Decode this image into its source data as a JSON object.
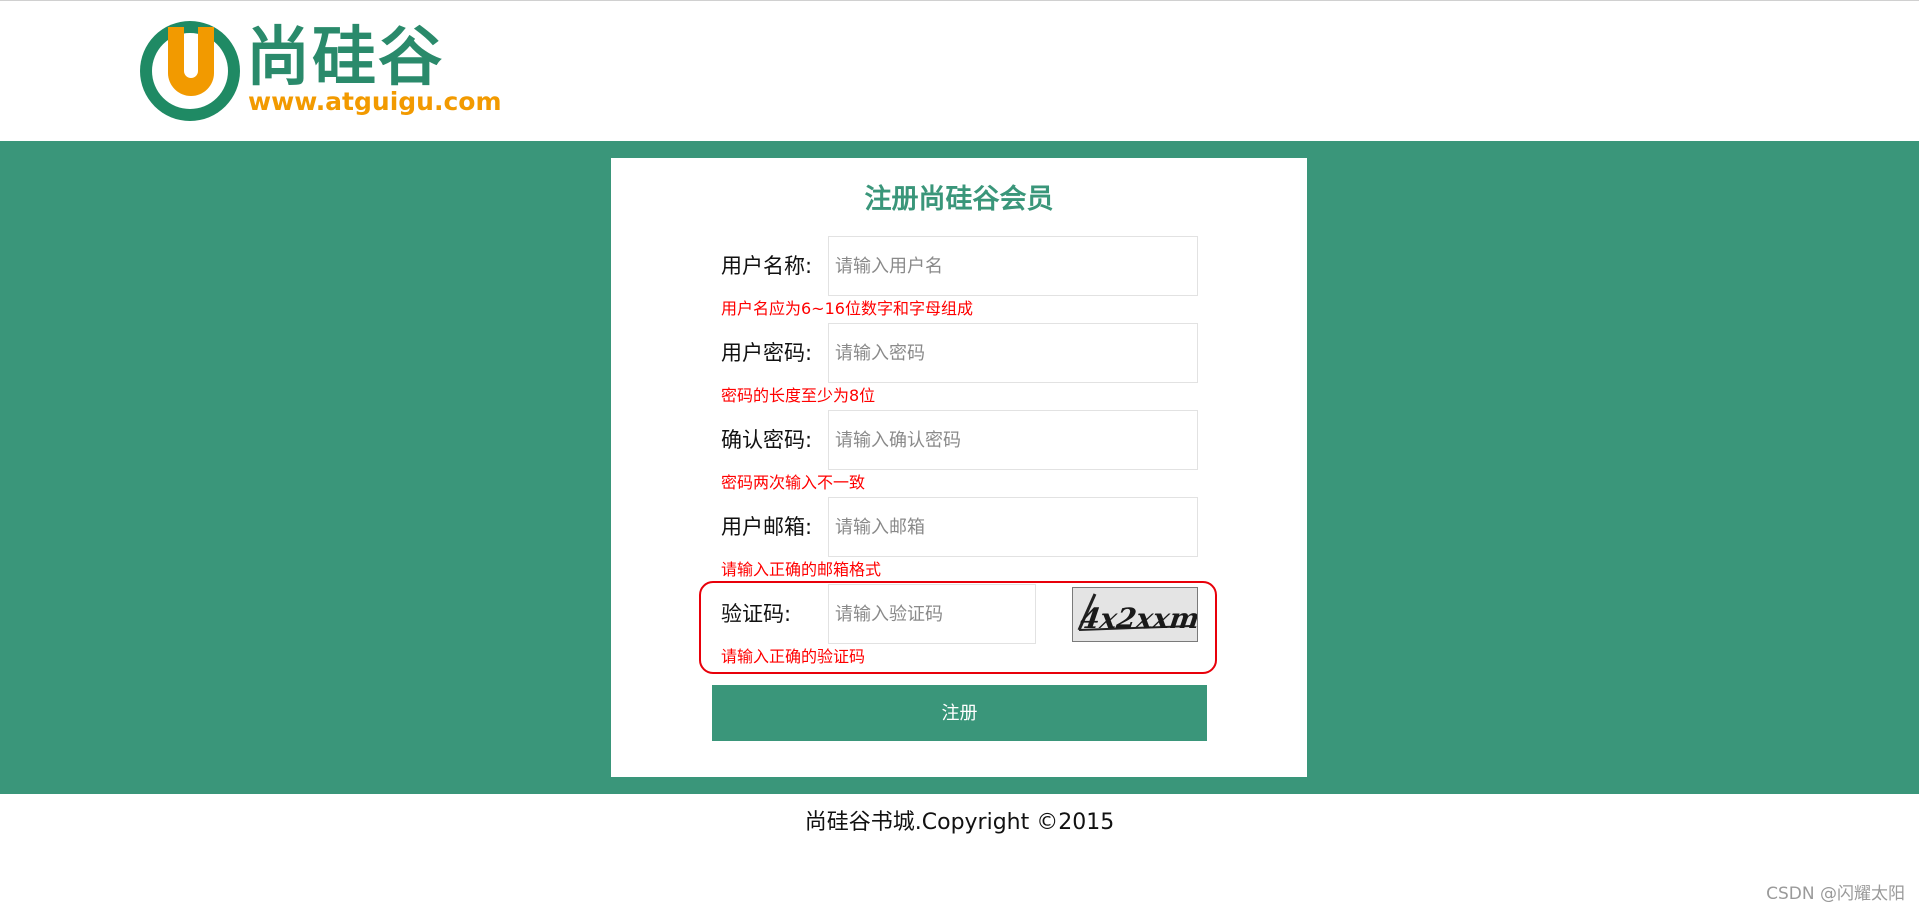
{
  "header": {
    "logo_title": "尚硅谷",
    "logo_url": "www.atguigu.com",
    "logo_letter": "U"
  },
  "form": {
    "title": "注册尚硅谷会员",
    "fields": [
      {
        "label": "用户名称:",
        "placeholder": "请输入用户名",
        "error": "用户名应为6~16位数字和字母组成"
      },
      {
        "label": "用户密码:",
        "placeholder": "请输入密码",
        "error": "密码的长度至少为8位"
      },
      {
        "label": "确认密码:",
        "placeholder": "请输入确认密码",
        "error": "密码两次输入不一致"
      },
      {
        "label": "用户邮箱:",
        "placeholder": "请输入邮箱",
        "error": "请输入正确的邮箱格式"
      },
      {
        "label": "验证码:",
        "placeholder": "请输入验证码",
        "error": "请输入正确的验证码"
      }
    ],
    "captcha_text": "4x2xxm",
    "submit_label": "注册"
  },
  "footer": {
    "copyright": "尚硅谷书城.Copyright ©2015"
  },
  "watermark": "CSDN @闪耀太阳",
  "colors": {
    "brand_green": "#3a967a",
    "logo_orange": "#f29a00",
    "error_red": "#ff0000",
    "highlight_red": "#e8000a"
  }
}
